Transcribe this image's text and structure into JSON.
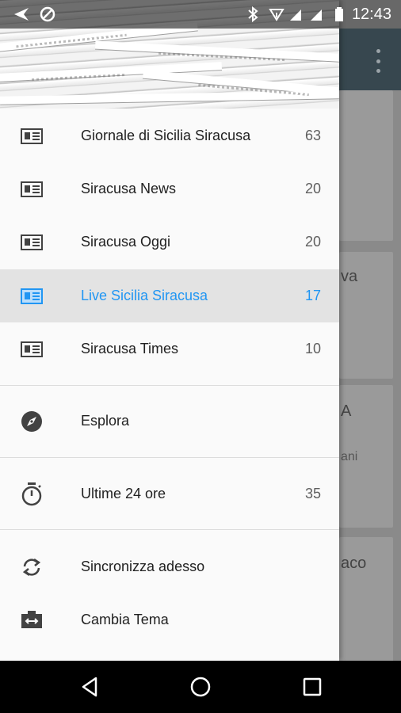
{
  "status_bar": {
    "time": "12:43"
  },
  "drawer": {
    "sources": [
      {
        "label": "Giornale di Sicilia Siracusa",
        "count": "63",
        "active": false
      },
      {
        "label": "Siracusa News",
        "count": "20",
        "active": false
      },
      {
        "label": "Siracusa Oggi",
        "count": "20",
        "active": false
      },
      {
        "label": "Live Sicilia Siracusa",
        "count": "17",
        "active": true
      },
      {
        "label": "Siracusa Times",
        "count": "10",
        "active": false
      }
    ],
    "explore": {
      "label": "Esplora"
    },
    "recent": {
      "label": "Ultime 24 ore",
      "count": "35"
    },
    "sync": {
      "label": "Sincronizza adesso"
    },
    "theme": {
      "label": "Cambia Tema"
    }
  },
  "background": {
    "fragments": [
      "va",
      "A",
      "ani",
      "aco"
    ]
  },
  "colors": {
    "accent": "#2196f3",
    "toolbar": "#37474f"
  }
}
